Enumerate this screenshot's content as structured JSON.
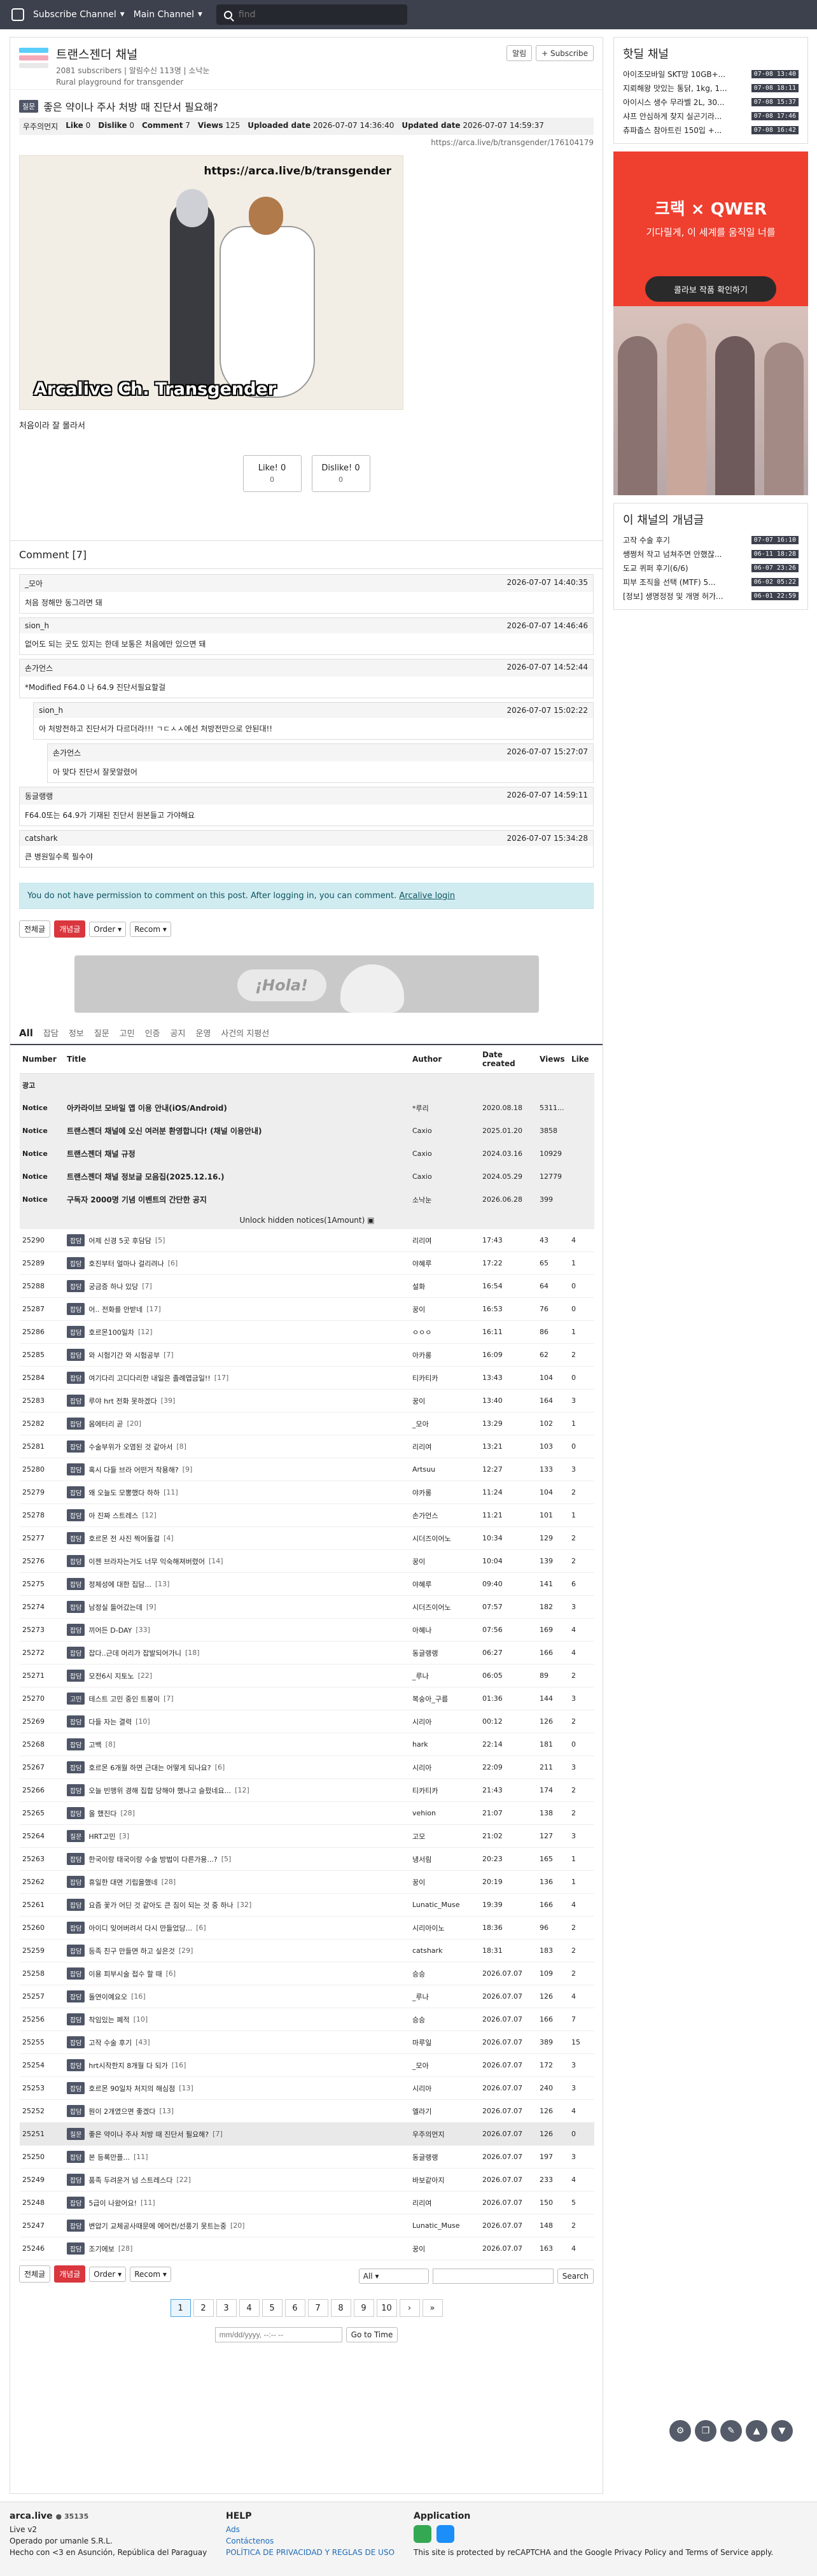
{
  "nav": {
    "menu1": "Subscribe Channel",
    "menu2": "Main Channel",
    "search_placeholder": "find"
  },
  "channel": {
    "title": "트랜스젠더 채널",
    "subscribers": "2081 subscribers",
    "alarm": "알림수신 113명",
    "owner": "소낙눈",
    "description": "Rural playground for transgender",
    "alarm_button": "알림",
    "subscribe_button": "+ Subscribe"
  },
  "post": {
    "badge": "질문",
    "title": "좋은 약이나 주사 처방 때 진단서 필요해?",
    "author": "우주의먼지",
    "like_label": "Like",
    "like_count": "0",
    "dislike_label": "Dislike",
    "dislike_count": "0",
    "comment_label": "Comment",
    "comment_count": "7",
    "views_label": "Views",
    "views_count": "125",
    "uploaded_label": "Uploaded date",
    "uploaded": "2026-07-07 14:36:40",
    "updated_label": "Updated date",
    "updated": "2026-07-07 14:59:37",
    "url": "https://arca.live/b/transgender/176104179",
    "image_url_text": "https://arca.live/b/transgender",
    "image_caption": "Arcalive Ch. Transgender",
    "body": "처음이라 잘 몰라서",
    "like_button": "Like! 0",
    "like_sub": "0",
    "dislike_button": "Dislike! 0",
    "dislike_sub": "0"
  },
  "comments": {
    "header": "Comment [7]",
    "items": [
      {
        "author": "_모아",
        "time": "2026-07-07 14:40:35",
        "text": "처음 정해만 동그라면 돼",
        "level": 0
      },
      {
        "author": "sion_h",
        "time": "2026-07-07 14:46:46",
        "text": "없어도 되는 곳도 있지는 한데 보통은 처음에만 있으면 돼",
        "level": 0
      },
      {
        "author": "손가언스",
        "time": "2026-07-07 14:52:44",
        "text": "*Modified F64.0 나 64.9 진단서필요할걸",
        "level": 0
      },
      {
        "author": "sion_h",
        "time": "2026-07-07 15:02:22",
        "text": "아 처방전하고 진단서가 다르더라!!! ㄱㄷㅅㅅ에선 처방전만으로 안된대!!",
        "level": 1
      },
      {
        "author": "손가언스",
        "time": "2026-07-07 15:27:07",
        "text": "아 맞다 진단서 잘못알렸어",
        "level": 2
      },
      {
        "author": "동글랭랭",
        "time": "2026-07-07 14:59:11",
        "text": "F64.0또는 64.9가 기재된 진단서 원본들고 가야해요",
        "level": 0
      },
      {
        "author": "catshark",
        "time": "2026-07-07 15:34:28",
        "text": "큰 병원일수록 필수야",
        "level": 0
      }
    ],
    "permission_text": "You do not have permission to comment on this post. After logging in, you can comment.",
    "login_link": "Arcalive login"
  },
  "toolbar": {
    "all": "전체글",
    "best": "개념글",
    "order": "Order",
    "recom": "Recom"
  },
  "banner": {
    "text": "¡Hola!"
  },
  "tabs": [
    "All",
    "잡담",
    "정보",
    "질문",
    "고민",
    "인증",
    "공지",
    "운영",
    "사건의 지평선"
  ],
  "table": {
    "headers": [
      "Number",
      "Title",
      "Author",
      "Date created",
      "Views",
      "Like"
    ],
    "ad_label": "광고",
    "notices": [
      {
        "label": "Notice",
        "title": "아카라이브 모바일 앱 이용 안내(iOS/Android)",
        "author": "*루리",
        "date": "2020.08.18",
        "views": "5311...",
        "like": ""
      },
      {
        "label": "Notice",
        "title": "트랜스젠더 채널에 오신 여러분 환영합니다! (채널 이용안내)",
        "author": "Caxio",
        "date": "2025.01.20",
        "views": "3858",
        "like": ""
      },
      {
        "label": "Notice",
        "title": "트랜스젠더 채널 규정",
        "author": "Caxio",
        "date": "2024.03.16",
        "views": "10929",
        "like": ""
      },
      {
        "label": "Notice",
        "title": "트랜스젠더 채널 정보글 모음집(2025.12.16.)",
        "author": "Caxio",
        "date": "2024.05.29",
        "views": "12779",
        "like": ""
      },
      {
        "label": "Notice",
        "title": "구독자 2000명 기념 이벤트의 간단한 공지",
        "author": "소낙눈",
        "date": "2026.06.28",
        "views": "399",
        "like": ""
      }
    ],
    "unlock": "Unlock hidden notices(1Amount)",
    "rows": [
      {
        "n": "25290",
        "b": "잡담",
        "t": "어제 신경 5곳 후담담",
        "c": "[5]",
        "a": "리리여",
        "d": "17:43",
        "v": "43",
        "l": "4"
      },
      {
        "n": "25289",
        "b": "잡담",
        "t": "호진부터 얼마나 걸리려나",
        "c": "[6]",
        "a": "야혜루",
        "d": "17:22",
        "v": "65",
        "l": "1"
      },
      {
        "n": "25288",
        "b": "잡담",
        "t": "궁금증 하나 있당",
        "c": "[7]",
        "a": "설화",
        "d": "16:54",
        "v": "64",
        "l": "0"
      },
      {
        "n": "25287",
        "b": "잡담",
        "t": "어.. 전화를 안받네",
        "c": "[17]",
        "a": "꿍이",
        "d": "16:53",
        "v": "76",
        "l": "0"
      },
      {
        "n": "25286",
        "b": "잡담",
        "t": "호르몬100일차",
        "c": "[12]",
        "a": "ㅇㅇㅇ",
        "d": "16:11",
        "v": "86",
        "l": "1"
      },
      {
        "n": "25285",
        "b": "잡담",
        "t": "와 시험기간 와 시험공부",
        "c": "[7]",
        "a": "아카롱",
        "d": "16:09",
        "v": "62",
        "l": "2"
      },
      {
        "n": "25284",
        "b": "잡담",
        "t": "여기다리 고디다리한 내일은 졸례엽금일!!",
        "c": "[17]",
        "a": "티카티카",
        "d": "13:43",
        "v": "104",
        "l": "0"
      },
      {
        "n": "25283",
        "b": "잡담",
        "t": "루야 hrt 전화 못하겠다",
        "c": "[39]",
        "a": "꿍이",
        "d": "13:40",
        "v": "164",
        "l": "3"
      },
      {
        "n": "25282",
        "b": "잡담",
        "t": "몸에터리 곧",
        "c": "[20]",
        "a": "_모아",
        "d": "13:29",
        "v": "102",
        "l": "1"
      },
      {
        "n": "25281",
        "b": "잡담",
        "t": "수술부위가 오염된 것 같아서",
        "c": "[8]",
        "a": "리리여",
        "d": "13:21",
        "v": "103",
        "l": "0"
      },
      {
        "n": "25280",
        "b": "잡담",
        "t": "혹시 다들 브라 어떤거 착용해?",
        "c": "[9]",
        "a": "Artsuu",
        "d": "12:27",
        "v": "133",
        "l": "3"
      },
      {
        "n": "25279",
        "b": "잡담",
        "t": "왜 오늘도 모뽕했다 하하",
        "c": "[11]",
        "a": "야카롱",
        "d": "11:24",
        "v": "104",
        "l": "2"
      },
      {
        "n": "25278",
        "b": "잡담",
        "t": "아 진짜 스트레스",
        "c": "[12]",
        "a": "손가언스",
        "d": "11:21",
        "v": "101",
        "l": "1"
      },
      {
        "n": "25277",
        "b": "잡담",
        "t": "호르몬 전 사진 찍어둘걸",
        "c": "[4]",
        "a": "시더즈이어노",
        "d": "10:34",
        "v": "129",
        "l": "2"
      },
      {
        "n": "25276",
        "b": "잡담",
        "t": "이젠 브라자는거도 너무 익숙해져버렸어",
        "c": "[14]",
        "a": "꿍이",
        "d": "10:04",
        "v": "139",
        "l": "2"
      },
      {
        "n": "25275",
        "b": "잡담",
        "t": "정체성에 대한 집담...",
        "c": "[13]",
        "a": "야혜루",
        "d": "09:40",
        "v": "141",
        "l": "6"
      },
      {
        "n": "25274",
        "b": "잡담",
        "t": "남정실 들어갔는데",
        "c": "[9]",
        "a": "시더즈이어노",
        "d": "07:57",
        "v": "182",
        "l": "3"
      },
      {
        "n": "25273",
        "b": "잡담",
        "t": "끼어든 D-DAY",
        "c": "[33]",
        "a": "아혜나",
        "d": "07:56",
        "v": "169",
        "l": "4"
      },
      {
        "n": "25272",
        "b": "잡담",
        "t": "잡다..근데 머리가 잡발되어가니",
        "c": "[18]",
        "a": "동글랭랭",
        "d": "06:27",
        "v": "166",
        "l": "4"
      },
      {
        "n": "25271",
        "b": "잡담",
        "t": "모전6시 지토노",
        "c": "[22]",
        "a": "_루나",
        "d": "06:05",
        "v": "89",
        "l": "2"
      },
      {
        "n": "25270",
        "b": "고민",
        "t": "테스트 고민 중인 트붕이",
        "c": "[7]",
        "a": "복숭아_구름",
        "d": "01:36",
        "v": "144",
        "l": "3"
      },
      {
        "n": "25269",
        "b": "잡담",
        "t": "다들 자는 결력",
        "c": "[10]",
        "a": "시리아",
        "d": "00:12",
        "v": "126",
        "l": "2"
      },
      {
        "n": "25268",
        "b": "잡담",
        "t": "고백",
        "c": "[8]",
        "a": "hark",
        "d": "22:14",
        "v": "181",
        "l": "0"
      },
      {
        "n": "25267",
        "b": "잡담",
        "t": "호르몬 6개월 하면 근대는 어떻게 되나요?",
        "c": "[6]",
        "a": "시리아",
        "d": "22:09",
        "v": "211",
        "l": "3"
      },
      {
        "n": "25266",
        "b": "잡담",
        "t": "오늘 빈맹위 경해 집합 당해야 했나고 슬펐네요...",
        "c": "[12]",
        "a": "티카티카",
        "d": "21:43",
        "v": "174",
        "l": "2"
      },
      {
        "n": "25265",
        "b": "잡담",
        "t": "올 했진다",
        "c": "[28]",
        "a": "vehion",
        "d": "21:07",
        "v": "138",
        "l": "2"
      },
      {
        "n": "25264",
        "b": "질문",
        "t": "HRT고민",
        "c": "[3]",
        "a": "고모",
        "d": "21:02",
        "v": "127",
        "l": "3"
      },
      {
        "n": "25263",
        "b": "잡담",
        "t": "한국이랑 태국이랑 수술 방법이 다른가용...?",
        "c": "[5]",
        "a": "냉서림",
        "d": "20:23",
        "v": "165",
        "l": "1"
      },
      {
        "n": "25262",
        "b": "잡담",
        "t": "휴일한 대면 기립을했네",
        "c": "[28]",
        "a": "꿍이",
        "d": "20:19",
        "v": "136",
        "l": "1"
      },
      {
        "n": "25261",
        "b": "잡담",
        "t": "요즘 꽃가 어딘 것 같아도 큰 짐이 되는 것 중 하나",
        "c": "[32]",
        "a": "Lunatic_Muse",
        "d": "19:39",
        "v": "166",
        "l": "4"
      },
      {
        "n": "25260",
        "b": "잡담",
        "t": "아이디 잊어버려서 다시 만들었당...",
        "c": "[6]",
        "a": "시리아이노",
        "d": "18:36",
        "v": "96",
        "l": "2"
      },
      {
        "n": "25259",
        "b": "잡담",
        "t": "등족 친구 만들면 하고 싶은것",
        "c": "[29]",
        "a": "catshark",
        "d": "18:31",
        "v": "183",
        "l": "2"
      },
      {
        "n": "25258",
        "b": "잡담",
        "t": "이용 피부시술 접수 할 때",
        "c": "[6]",
        "a": "승승",
        "d": "2026.07.07",
        "v": "109",
        "l": "2"
      },
      {
        "n": "25257",
        "b": "잡담",
        "t": "돌연이예요오",
        "c": "[16]",
        "a": "_루나",
        "d": "2026.07.07",
        "v": "126",
        "l": "4"
      },
      {
        "n": "25256",
        "b": "잡담",
        "t": "착임있는 폐적",
        "c": "[10]",
        "a": "승승",
        "d": "2026.07.07",
        "v": "166",
        "l": "7"
      },
      {
        "n": "25255",
        "b": "잡담",
        "t": "고작 수술 후기",
        "c": "[43]",
        "a": "마루일",
        "d": "2026.07.07",
        "v": "389",
        "l": "15"
      },
      {
        "n": "25254",
        "b": "잡담",
        "t": "hrt시작한지 8개월 다 되가",
        "c": "[16]",
        "a": "_모아",
        "d": "2026.07.07",
        "v": "172",
        "l": "3"
      },
      {
        "n": "25253",
        "b": "잡담",
        "t": "호르몬 90일차 처지의 해심점",
        "c": "[13]",
        "a": "시리아",
        "d": "2026.07.07",
        "v": "240",
        "l": "3"
      },
      {
        "n": "25252",
        "b": "잡담",
        "t": "뭔이 2개였으면 좋겠다",
        "c": "[13]",
        "a": "엘라기",
        "d": "2026.07.07",
        "v": "126",
        "l": "4"
      },
      {
        "n": "25251",
        "b": "질문",
        "t": "좋은 약이나 주사 처방 때 진단서 필요해?",
        "c": "[7]",
        "a": "우주의먼지",
        "d": "2026.07.07",
        "v": "126",
        "l": "0"
      },
      {
        "n": "25250",
        "b": "잡담",
        "t": "본 등록만플...",
        "c": "[11]",
        "a": "동글랭랭",
        "d": "2026.07.07",
        "v": "197",
        "l": "3"
      },
      {
        "n": "25249",
        "b": "잡담",
        "t": "품족 두려운거 넘 스트레스다",
        "c": "[22]",
        "a": "바보같아지",
        "d": "2026.07.07",
        "v": "233",
        "l": "4"
      },
      {
        "n": "25248",
        "b": "잡담",
        "t": "5급이 나왔어요!",
        "c": "[11]",
        "a": "리리여",
        "d": "2026.07.07",
        "v": "150",
        "l": "5"
      },
      {
        "n": "25247",
        "b": "잡담",
        "t": "변압기 교체공사때문에 에어컨/선풍기 못트는중",
        "c": "[20]",
        "a": "Lunatic_Muse",
        "d": "2026.07.07",
        "v": "148",
        "l": "2"
      },
      {
        "n": "25246",
        "b": "잡담",
        "t": "조기에보",
        "c": "[28]",
        "a": "꿍이",
        "d": "2026.07.07",
        "v": "163",
        "l": "4"
      }
    ]
  },
  "search_bottom": {
    "select": "All",
    "button": "Search"
  },
  "pagination": {
    "pages": [
      "1",
      "2",
      "3",
      "4",
      "5",
      "6",
      "7",
      "8",
      "9",
      "10"
    ],
    "next": "›",
    "last": "»"
  },
  "goto": {
    "placeholder": "mm/dd/yyyy, --:-- --",
    "button": "Go to Time"
  },
  "sidebar": {
    "hot_title": "핫딜 채널",
    "hot": [
      {
        "t": "아이조모바일 SKT망 10GB+...",
        "d": "07-08 13:40"
      },
      {
        "t": "지뢰해왕 맛있는 통닭, 1kg, 1...",
        "d": "07-08 18:11"
      },
      {
        "t": "아이시스 생수 무라벨 2L, 30...",
        "d": "07-08 15:37"
      },
      {
        "t": "샤프 안심하게 찾지 실곤기라...",
        "d": "07-08 17:46"
      },
      {
        "t": "츄파춥스 참아트린 150입 +...",
        "d": "07-08 16:42"
      }
    ],
    "best_title": "이 채널의 개념글",
    "best": [
      {
        "t": "고작 수술 후기",
        "d": "07-07 16:10"
      },
      {
        "t": "쌩쩡처 작고 넘쳐주면 안했잖...",
        "d": "06-11 18:28"
      },
      {
        "t": "도교 퀴퍼 후기(6/6)",
        "d": "06-07 23:26"
      },
      {
        "t": "피부 조직을 선택 (MTF) 5...",
        "d": "06-02 05:22"
      },
      {
        "t": "[정보] 생명정정 및 개명 허가...",
        "d": "06-01 22:59"
      }
    ],
    "ad_head": "크랙 × QWER",
    "ad_sub": "기다릴게, 이 세계를 움직일 너를",
    "ad_btn": "콜라보 작품 확인하기"
  },
  "footer": {
    "site": "arca.live",
    "site_count": "35135",
    "version": "Live v2",
    "operator": "Operado por umanle S.R.L.",
    "made": "Hecho con <3 en Asunción, República del Paraguay",
    "help_title": "HELP",
    "help1": "Ads",
    "help2": "Contáctenos",
    "help3": "POLÍTICA DE PRIVACIDAD Y REGLAS DE USO",
    "app_title": "Application",
    "recaptcha": "This site is protected by reCAPTCHA and the Google Privacy Policy and Terms of Service apply."
  },
  "colors": {
    "nav": "#3d414d",
    "accent_red": "#d9363e",
    "notice_blue": "#d1ecf1"
  }
}
